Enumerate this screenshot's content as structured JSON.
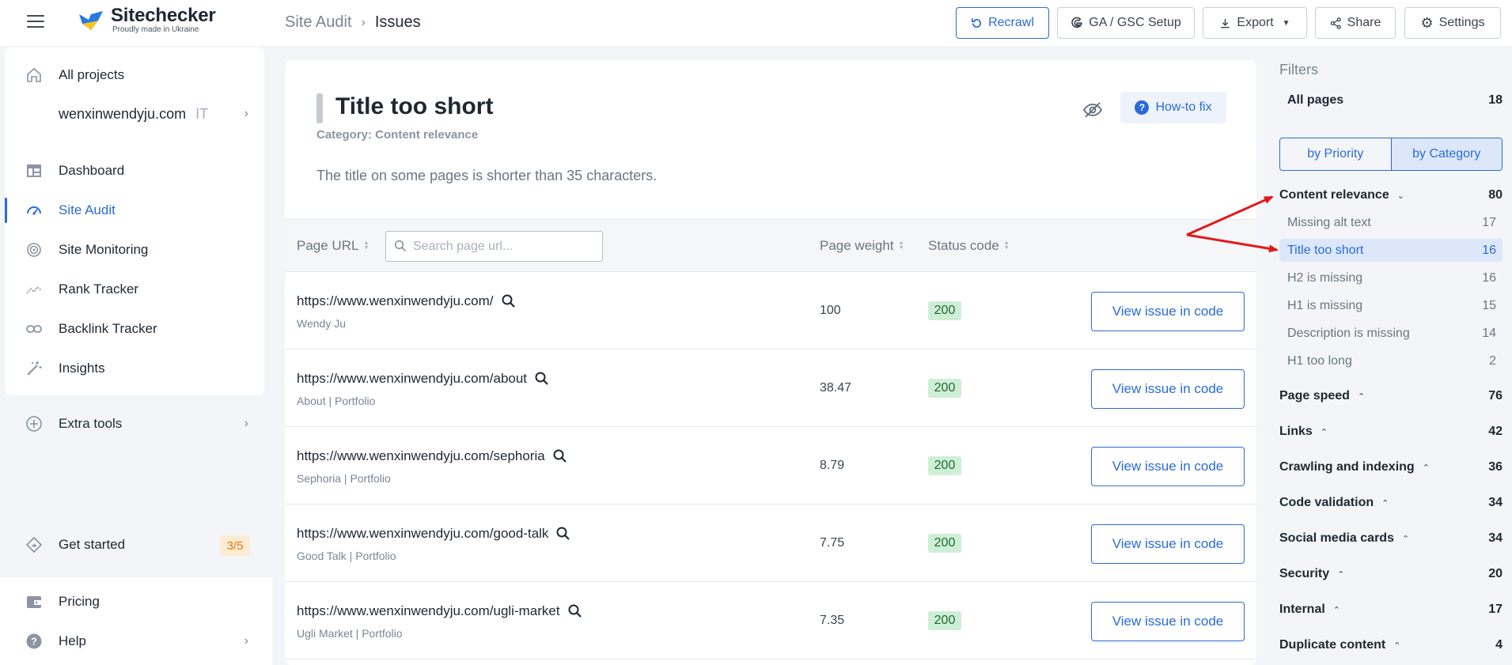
{
  "header": {
    "logo_name": "Sitechecker",
    "logo_sub": "Proudly made in Ukraine",
    "breadcrumb_parent": "Site Audit",
    "breadcrumb_current": "Issues",
    "buttons": {
      "recrawl": "Recrawl",
      "ga_gsc": "GA / GSC Setup",
      "export": "Export",
      "share": "Share",
      "settings": "Settings"
    }
  },
  "sidebar": {
    "all_projects": "All projects",
    "project_name": "wenxinwendyju.com",
    "project_tag": "IT",
    "items": [
      {
        "label": "Dashboard",
        "icon": "dashboard-icon"
      },
      {
        "label": "Site Audit",
        "icon": "gauge-icon"
      },
      {
        "label": "Site Monitoring",
        "icon": "monitoring-icon"
      },
      {
        "label": "Rank Tracker",
        "icon": "rank-icon"
      },
      {
        "label": "Backlink Tracker",
        "icon": "link-icon"
      },
      {
        "label": "Insights",
        "icon": "magic-wand-icon"
      }
    ],
    "extra_tools": "Extra tools",
    "get_started": "Get started",
    "get_started_progress": "3/5",
    "pricing": "Pricing",
    "help": "Help"
  },
  "issue": {
    "title": "Title too short",
    "category": "Category: Content relevance",
    "description": "The title on some pages is shorter than 35 characters.",
    "howto": "How-to fix"
  },
  "table": {
    "columns": {
      "url": "Page URL",
      "weight": "Page weight",
      "status": "Status code"
    },
    "search_placeholder": "Search page url...",
    "action_label": "View issue in code",
    "rows": [
      {
        "url": "https://www.wenxinwendyju.com/",
        "title": "Wendy Ju",
        "weight": "100",
        "status": "200"
      },
      {
        "url": "https://www.wenxinwendyju.com/about",
        "title": "About | Portfolio",
        "weight": "38.47",
        "status": "200"
      },
      {
        "url": "https://www.wenxinwendyju.com/sephoria",
        "title": "Sephoria | Portfolio",
        "weight": "8.79",
        "status": "200"
      },
      {
        "url": "https://www.wenxinwendyju.com/good-talk",
        "title": "Good Talk | Portfolio",
        "weight": "7.75",
        "status": "200"
      },
      {
        "url": "https://www.wenxinwendyju.com/ugli-market",
        "title": "Ugli Market | Portfolio",
        "weight": "7.35",
        "status": "200"
      }
    ]
  },
  "filters": {
    "title": "Filters",
    "all_pages": "All pages",
    "all_pages_count": "18",
    "by_priority": "by Priority",
    "by_category": "by Category",
    "content_relevance": {
      "label": "Content relevance",
      "count": "80"
    },
    "content_items": [
      {
        "label": "Missing alt text",
        "count": "17"
      },
      {
        "label": "Title too short",
        "count": "16"
      },
      {
        "label": "H2 is missing",
        "count": "16"
      },
      {
        "label": "H1 is missing",
        "count": "15"
      },
      {
        "label": "Description is missing",
        "count": "14"
      },
      {
        "label": "H1 too long",
        "count": "2"
      }
    ],
    "categories": [
      {
        "label": "Page speed",
        "count": "76"
      },
      {
        "label": "Links",
        "count": "42"
      },
      {
        "label": "Crawling and indexing",
        "count": "36"
      },
      {
        "label": "Code validation",
        "count": "34"
      },
      {
        "label": "Social media cards",
        "count": "34"
      },
      {
        "label": "Security",
        "count": "20"
      },
      {
        "label": "Internal",
        "count": "17"
      },
      {
        "label": "Duplicate content",
        "count": "4"
      }
    ]
  },
  "colors": {
    "accent": "#2a6bd8",
    "status_ok_bg": "#cfeed6",
    "annotation": "#e0191c"
  }
}
